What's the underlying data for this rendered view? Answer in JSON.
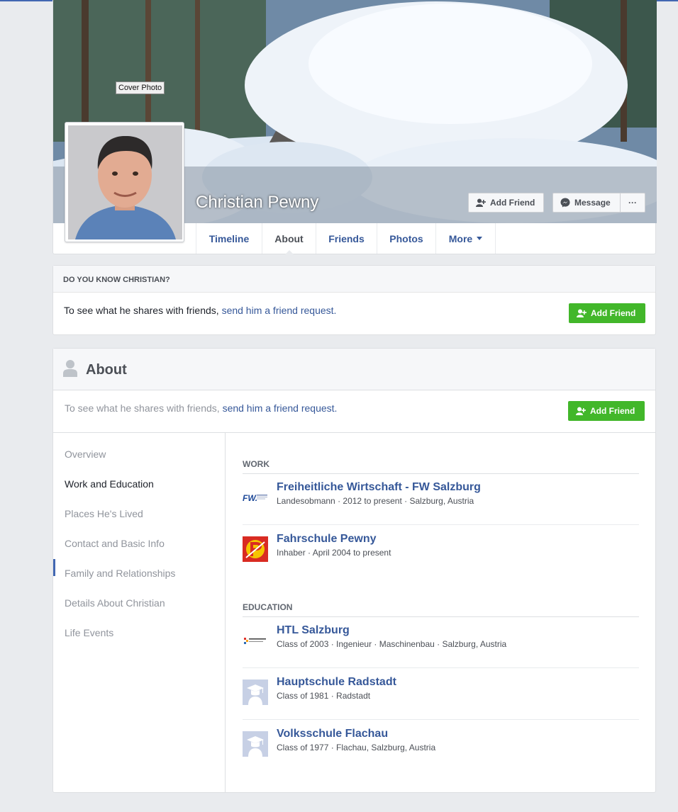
{
  "profile": {
    "cover_tooltip": "Cover Photo",
    "name": "Christian Pewny",
    "add_friend_label": "Add Friend",
    "message_label": "Message",
    "more_dots_label": "···",
    "tabs": [
      {
        "label": "Timeline"
      },
      {
        "label": "About"
      },
      {
        "label": "Friends"
      },
      {
        "label": "Photos"
      },
      {
        "label": "More"
      }
    ],
    "active_tab": "About"
  },
  "know_box": {
    "heading": "DO YOU KNOW CHRISTIAN?",
    "text_prefix": "To see what he shares with friends, ",
    "link_text": "send him a friend request.",
    "button_label": "Add Friend"
  },
  "about": {
    "title": "About",
    "sub_text_prefix": "To see what he shares with friends, ",
    "sub_link_text": "send him a friend request.",
    "button_label": "Add Friend",
    "sidebar": [
      {
        "label": "Overview"
      },
      {
        "label": "Work and Education"
      },
      {
        "label": "Places He's Lived"
      },
      {
        "label": "Contact and Basic Info"
      },
      {
        "label": "Family and Relationships"
      },
      {
        "label": "Details About Christian"
      },
      {
        "label": "Life Events"
      }
    ],
    "active_sidebar": "Work and Education",
    "work_heading": "WORK",
    "work": [
      {
        "name": "Freiheitliche Wirtschaft - FW Salzburg",
        "meta": "Landesobmann · 2012 to present · Salzburg, Austria",
        "logo": "fw-logo"
      },
      {
        "name": "Fahrschule Pewny",
        "meta": "Inhaber · April 2004 to present",
        "logo": "fahrschule-logo"
      }
    ],
    "education_heading": "EDUCATION",
    "education": [
      {
        "name": "HTL Salzburg",
        "meta": "Class of 2003 · Ingenieur · Maschinenbau · Salzburg, Austria",
        "logo": "htl-logo"
      },
      {
        "name": "Hauptschule Radstadt",
        "meta": "Class of 1981 · Radstadt",
        "logo": "graduation-cap-icon"
      },
      {
        "name": "Volksschule Flachau",
        "meta": "Class of 1977 · Flachau, Salzburg, Austria",
        "logo": "graduation-cap-icon"
      }
    ]
  },
  "colors": {
    "link": "#365899",
    "green_button": "#42b72a",
    "background": "#e9ebee",
    "accent": "#4267b2"
  }
}
